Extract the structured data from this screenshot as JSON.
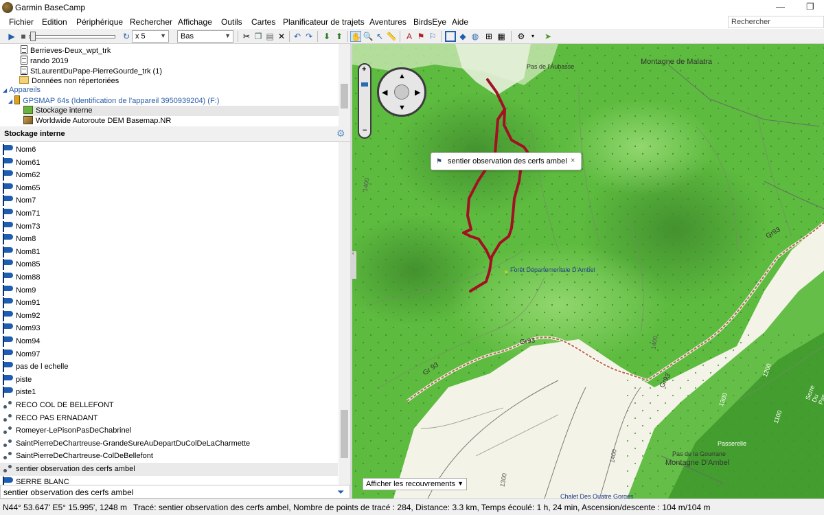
{
  "app": {
    "title": "Garmin BaseCamp",
    "window_minimize": "—",
    "window_maximize": "❐"
  },
  "menu": [
    "Fichier",
    "Edition",
    "Périphérique",
    "Rechercher",
    "Affichage",
    "Outils",
    "Cartes",
    "Planificateur de trajets",
    "Aventures",
    "BirdsEye",
    "Aide"
  ],
  "search": {
    "placeholder": "Rechercher"
  },
  "toolbar": {
    "speed": "x 5",
    "position": "Bas"
  },
  "tree": {
    "items": [
      "Berrieves-Deux_wpt_trk",
      "rando 2019",
      "StLaurentDuPape-PierreGourde_trk (1)",
      "Données non répertoriées"
    ],
    "devices_header": "Appareils",
    "device": "GPSMAP 64s (Identification de l'appareil 3950939204) (F:)",
    "storage": "Stockage interne",
    "basemap": "Worldwide Autoroute DEM Basemap.NR"
  },
  "section": {
    "title": "Stockage interne"
  },
  "list": [
    {
      "label": "Nom6",
      "type": "waypoint"
    },
    {
      "label": "Nom61",
      "type": "waypoint"
    },
    {
      "label": "Nom62",
      "type": "waypoint"
    },
    {
      "label": "Nom65",
      "type": "waypoint"
    },
    {
      "label": "Nom7",
      "type": "waypoint"
    },
    {
      "label": "Nom71",
      "type": "waypoint"
    },
    {
      "label": "Nom73",
      "type": "waypoint"
    },
    {
      "label": "Nom8",
      "type": "waypoint"
    },
    {
      "label": "Nom81",
      "type": "waypoint"
    },
    {
      "label": "Nom85",
      "type": "waypoint"
    },
    {
      "label": "Nom88",
      "type": "waypoint"
    },
    {
      "label": "Nom9",
      "type": "waypoint"
    },
    {
      "label": "Nom91",
      "type": "waypoint"
    },
    {
      "label": "Nom92",
      "type": "waypoint"
    },
    {
      "label": "Nom93",
      "type": "waypoint"
    },
    {
      "label": "Nom94",
      "type": "waypoint"
    },
    {
      "label": "Nom97",
      "type": "waypoint"
    },
    {
      "label": "pas de l echelle",
      "type": "waypoint"
    },
    {
      "label": "piste",
      "type": "waypoint"
    },
    {
      "label": "piste1",
      "type": "waypoint"
    },
    {
      "label": "RECO COL DE BELLEFONT",
      "type": "track"
    },
    {
      "label": "RECO PAS ERNADANT",
      "type": "track"
    },
    {
      "label": "Romeyer-LePisonPasDeChabrinel",
      "type": "track"
    },
    {
      "label": "SaintPierreDeChartreuse-GrandeSureAuDepartDuColDeLaCharmette",
      "type": "track"
    },
    {
      "label": "SaintPierreDeChartreuse-ColDeBellefont",
      "type": "track"
    },
    {
      "label": "sentier observation des cerfs  ambel",
      "type": "track",
      "selected": true
    },
    {
      "label": "SERRE BLANC",
      "type": "waypoint"
    }
  ],
  "filter": {
    "value": "sentier observation des cerfs  ambel"
  },
  "map": {
    "callout": "sentier observation des cerfs  ambel",
    "callout_close": "×",
    "overlay_select": "Afficher les recouvrements",
    "labels": [
      "Pas de l'Aubasse",
      "Montagne de Malatra",
      "Forêt Départementale D'Ambel",
      "Gr93",
      "Gr93",
      "Gr 93",
      "Gr93",
      "Pas de la Gourrane",
      "Montagne D'Ambel",
      "Passerelle",
      "Chalet Des Quatre Gorges",
      "Serre Du Pas",
      "1400",
      "1300",
      "1400",
      "1200",
      "1100",
      "1300",
      "1400"
    ],
    "colors": {
      "forest": "#5dbb3f",
      "light": "#f3f3e7",
      "track": "#a31023",
      "trail": "#b86a4c"
    }
  },
  "status": {
    "coords": "N44° 53.647' E5° 15.995', 1248 m",
    "track_info": "Tracé: sentier observation des cerfs  ambel, Nombre de points de tracé : 284, Distance: 3.3 km, Temps écoulé: 1 h, 24 min, Ascension/descente : 104 m/104 m"
  }
}
